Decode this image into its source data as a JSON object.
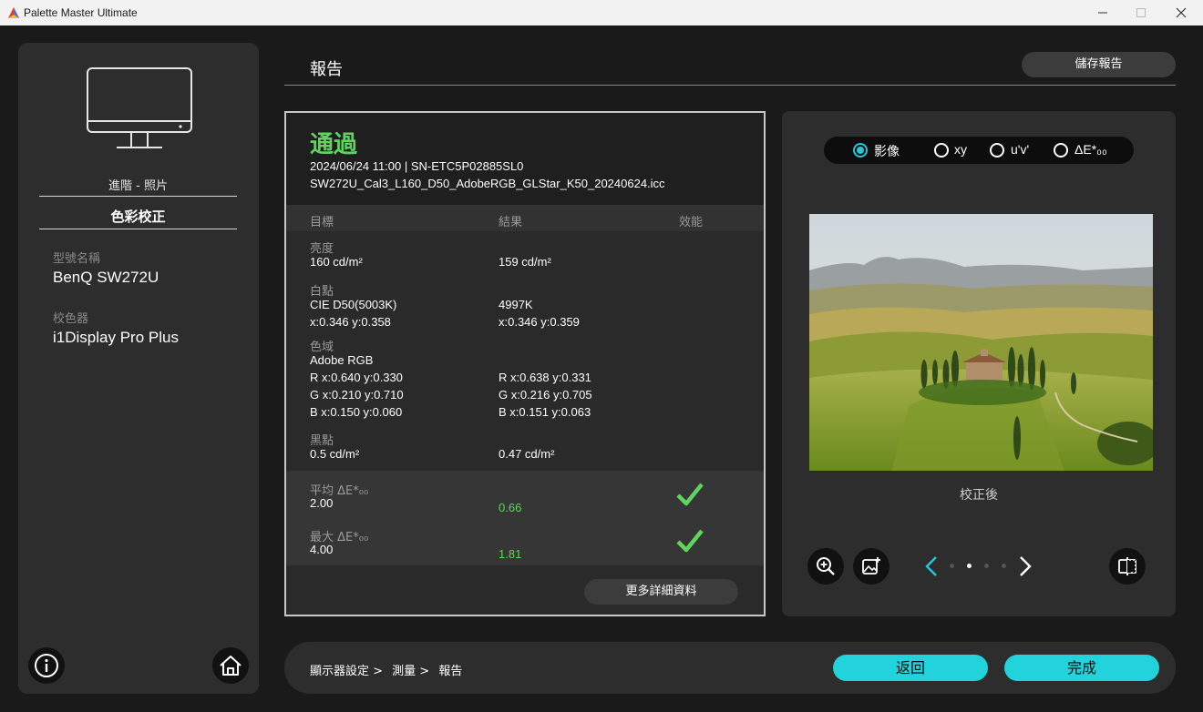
{
  "window": {
    "title": "Palette Master Ultimate"
  },
  "sidebar": {
    "mode": "進階 - 照片",
    "section": "色彩校正",
    "model_label": "型號名稱",
    "model_value": "BenQ SW272U",
    "calibrator_label": "校色器",
    "calibrator_value": "i1Display Pro Plus"
  },
  "header": {
    "title": "報告",
    "save_report": "儲存報告"
  },
  "report": {
    "status": "通過",
    "status_color": "#5ed35e",
    "datetime_serial": "2024/06/24 11:00 | SN-ETC5P02885SL0",
    "profile": "SW272U_Cal3_L160_D50_AdobeRGB_GLStar_K50_20240624.icc",
    "columns": [
      "目標",
      "結果",
      "效能"
    ],
    "luminance": {
      "label": "亮度",
      "target": "160 cd/m²",
      "result": "159 cd/m²"
    },
    "white_point": {
      "label": "白點",
      "target": "CIE D50(5003K)",
      "target_xy": "x:0.346 y:0.358",
      "result": "4997K",
      "result_xy": "x:0.346 y:0.359"
    },
    "gamut": {
      "label": "色域",
      "target": "Adobe RGB",
      "target_r": "R x:0.640 y:0.330",
      "result_r": "R x:0.638 y:0.331",
      "target_g": "G x:0.210 y:0.710",
      "result_g": "G x:0.216 y:0.705",
      "target_b": "B x:0.150 y:0.060",
      "result_b": "B x:0.151 y:0.063"
    },
    "black_point": {
      "label": "黑點",
      "target": "0.5 cd/m²",
      "result": "0.47 cd/m²"
    },
    "avg_de": {
      "label": "平均 ΔE*₀₀",
      "target": "2.00",
      "result": "0.66"
    },
    "max_de": {
      "label": "最大 ΔE*₀₀",
      "target": "4.00",
      "result": "1.81"
    },
    "more_details": "更多詳細資料"
  },
  "preview": {
    "options": [
      "影像",
      "xy",
      "u'v'",
      "ΔE*₀₀"
    ],
    "selected": "影像",
    "caption": "校正後",
    "page": 2,
    "page_count": 4,
    "accent": "#22c9d6"
  },
  "footer": {
    "breadcrumb": [
      "顯示器設定 >",
      "測量 >",
      "報告"
    ],
    "back": "返回",
    "done": "完成"
  }
}
